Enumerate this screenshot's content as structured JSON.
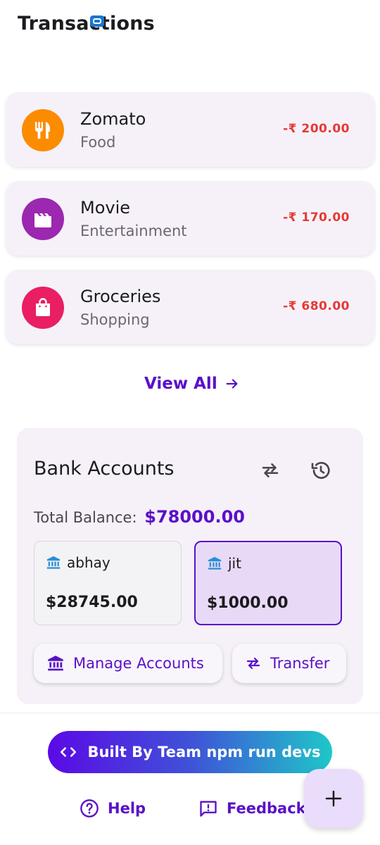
{
  "header": {
    "title": "Transactions"
  },
  "transactions": [
    {
      "name": "Zomato",
      "category": "Food",
      "amount": "-₹ 200.00",
      "icon": "fork-knife-icon",
      "color": "#fb8c00"
    },
    {
      "name": "Movie",
      "category": "Entertainment",
      "amount": "-₹ 170.00",
      "icon": "clapperboard-icon",
      "color": "#9c27b0"
    },
    {
      "name": "Groceries",
      "category": "Shopping",
      "amount": "-₹ 680.00",
      "icon": "shopping-bag-icon",
      "color": "#e91e63"
    }
  ],
  "view_all": {
    "label": "View All"
  },
  "bank": {
    "title": "Bank Accounts",
    "total_label": "Total Balance:",
    "total_value": "$78000.00",
    "accounts": [
      {
        "name": "abhay",
        "balance": "$28745.00",
        "selected": false
      },
      {
        "name": "jit",
        "balance": "$1000.00",
        "selected": true
      }
    ],
    "manage_label": "Manage Accounts",
    "transfer_label": "Transfer"
  },
  "footer": {
    "built_by": "Built By Team npm run devs",
    "help": "Help",
    "feedback": "Feedback"
  },
  "colors": {
    "accent": "#5a10c8",
    "expense": "#e53935",
    "card_bg": "#f6f1f9",
    "gradient_start": "#5b09e6",
    "gradient_end": "#1fc7c8"
  }
}
